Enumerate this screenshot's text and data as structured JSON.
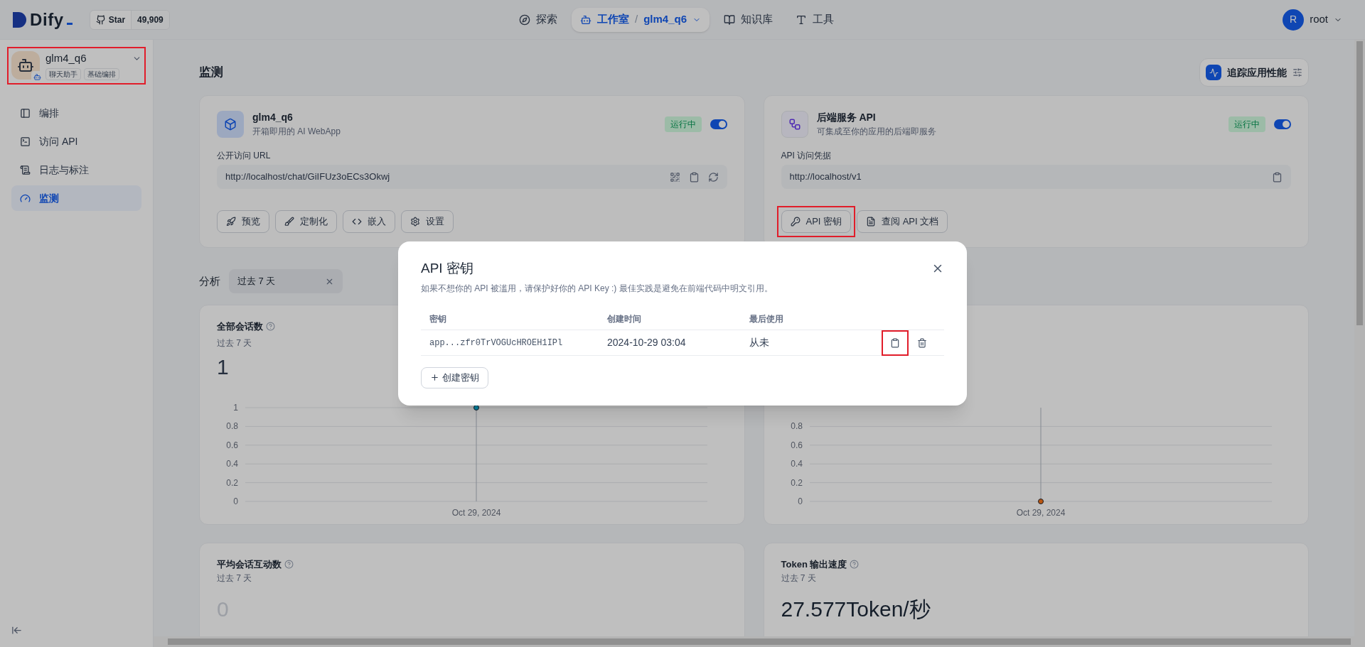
{
  "topbar": {
    "logo": "Dify",
    "star_label": "Star",
    "star_count": "49,909",
    "nav": [
      {
        "label": "探索",
        "selected": false
      },
      {
        "label": "工作室",
        "selected": true,
        "separator": "/",
        "crumb": "glm4_q6"
      },
      {
        "label": "知识库",
        "selected": false
      },
      {
        "label": "工具",
        "selected": false
      }
    ],
    "user": {
      "initial": "R",
      "name": "root"
    }
  },
  "sidebar": {
    "app": {
      "name": "glm4_q6",
      "tags": [
        "聊天助手",
        "基础编排"
      ],
      "highlighted": true
    },
    "items": [
      {
        "label": "编排",
        "selected": false
      },
      {
        "label": "访问 API",
        "selected": false
      },
      {
        "label": "日志与标注",
        "selected": false
      },
      {
        "label": "监测",
        "selected": true
      }
    ]
  },
  "page": {
    "title": "监测",
    "trace_button": "追踪应用性能"
  },
  "cards": [
    {
      "kind": "webapp",
      "title": "glm4_q6",
      "subtitle": "开箱即用的 AI WebApp",
      "status": "运行中",
      "on": true,
      "field_label": "公开访问 URL",
      "url": "http://localhost/chat/GiIFUz3oECs3Okwj",
      "actions": [
        {
          "label": "预览",
          "highlighted": false
        },
        {
          "label": "定制化",
          "highlighted": false
        },
        {
          "label": "嵌入",
          "highlighted": false
        },
        {
          "label": "设置",
          "highlighted": false
        }
      ]
    },
    {
      "kind": "api",
      "title": "后端服务 API",
      "subtitle": "可集成至你的应用的后端即服务",
      "status": "运行中",
      "on": true,
      "field_label": "API 访问凭据",
      "url": "http://localhost/v1",
      "actions": [
        {
          "label": "API 密钥",
          "highlighted": true
        },
        {
          "label": "查阅 API 文档",
          "highlighted": false
        }
      ]
    }
  ],
  "analysis": {
    "label": "分析",
    "period": "过去 7 天"
  },
  "charts": [
    {
      "title": "全部会话数",
      "subtitle": "过去 7 天",
      "total": "1",
      "chart_data": {
        "type": "line",
        "grid": true,
        "categories": [
          "Oct 29, 2024"
        ],
        "series": [
          {
            "color": "#06aed4",
            "marker": true,
            "values": [
              1
            ]
          }
        ],
        "ref_lines": [
          {
            "axis": "x",
            "value": "Oct 29, 2024"
          }
        ],
        "ylim": [
          0,
          1
        ],
        "yticks": [
          0,
          0.2,
          0.4,
          0.6,
          0.8,
          1
        ]
      }
    },
    {
      "chart_data": {
        "type": "line",
        "grid": true,
        "categories": [
          "Oct 29, 2024"
        ],
        "series": [
          {
            "color": "#f97316",
            "marker": true,
            "values": [
              0
            ]
          }
        ],
        "ref_lines": [
          {
            "axis": "x",
            "value": "Oct 29, 2024"
          }
        ],
        "ylim": [
          0,
          1
        ],
        "yticks": [
          0,
          0.2,
          0.4,
          0.6,
          0.8
        ]
      }
    }
  ],
  "stats": [
    {
      "title": "平均会话互动数",
      "subtitle": "过去 7 天",
      "value": "0",
      "muted": true
    },
    {
      "title": "Token 输出速度",
      "subtitle": "过去 7 天",
      "value": "27.577Token/秒",
      "muted": false
    }
  ],
  "modal": {
    "title": "API 密钥",
    "description": "如果不想你的 API 被滥用，请保护好你的 API Key :) 最佳实践是避免在前端代码中明文引用。",
    "columns": [
      "密钥",
      "创建时间",
      "最后使用"
    ],
    "rows": [
      {
        "key": "app...zfr0TrVOGUcHROEH1IPl",
        "created": "2024-10-29 03:04",
        "last_used": "从未",
        "copy_highlighted": true
      }
    ],
    "create_button": "创建密钥"
  }
}
